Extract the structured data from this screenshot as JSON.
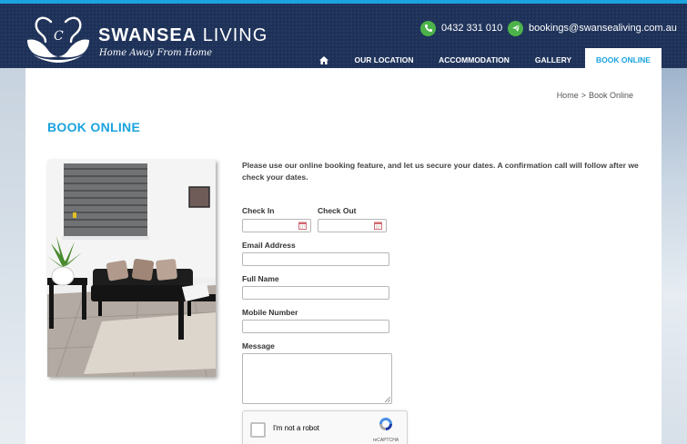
{
  "brand": {
    "name_part1": "SWANSEA",
    "name_part2": "LIVING",
    "tagline": "Home Away From Home",
    "accent_color": "#1aa3de",
    "header_color": "#1d3159",
    "icon": "swans-logo-icon"
  },
  "contact": {
    "phone": "0432 331 010",
    "phone_icon": "phone-icon",
    "email": "bookings@swansealiving.com.au",
    "email_icon": "send-icon"
  },
  "nav": {
    "home_icon": "home-icon",
    "items": [
      {
        "label": "OUR LOCATION"
      },
      {
        "label": "ACCOMMODATION"
      },
      {
        "label": "GALLERY"
      },
      {
        "label": "BOOK ONLINE",
        "active": true
      }
    ]
  },
  "breadcrumb": {
    "home": "Home",
    "separator": ">",
    "current": "Book Online"
  },
  "page": {
    "title": "BOOK ONLINE",
    "intro": "Please use our online booking feature, and let us secure your dates. A confirmation call will follow after we check your dates."
  },
  "form": {
    "check_in_label": "Check In",
    "check_in_value": "",
    "check_out_label": "Check Out",
    "check_out_value": "",
    "email_label": "Email Address",
    "email_value": "",
    "name_label": "Full Name",
    "name_value": "",
    "mobile_label": "Mobile Number",
    "mobile_value": "",
    "message_label": "Message",
    "message_value": "",
    "calendar_icon": "calendar-icon"
  },
  "recaptcha": {
    "label": "I'm not a robot",
    "brand": "reCAPTCHA",
    "checked": false
  }
}
